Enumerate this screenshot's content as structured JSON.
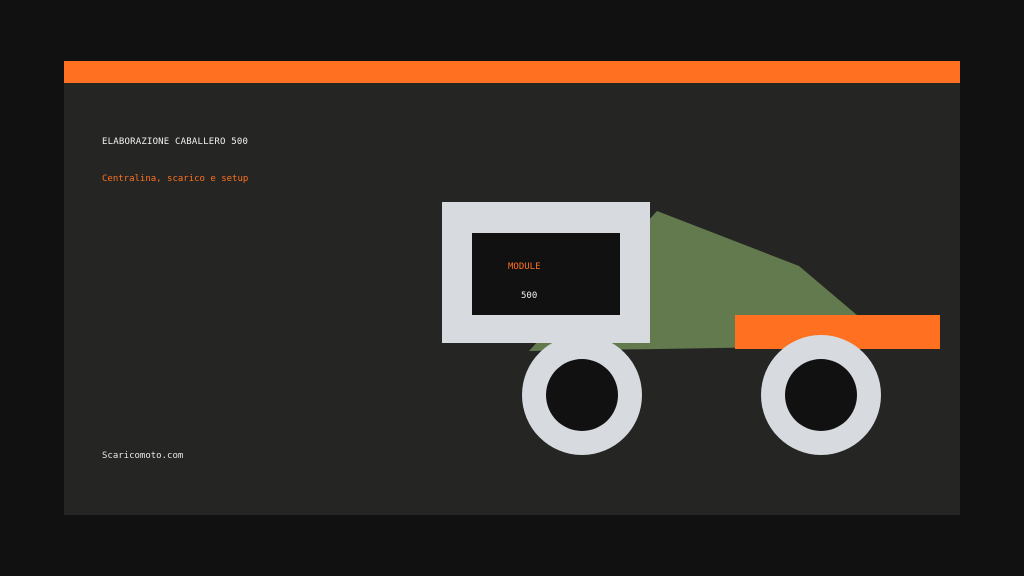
{
  "header": {
    "title": "ELABORAZIONE CABALLERO 500",
    "subtitle": "Centralina, scarico e setup"
  },
  "module": {
    "label": "MODULE",
    "value": "500"
  },
  "footer": {
    "site": "Scaricomoto.com"
  },
  "colors": {
    "accent": "#ff7020",
    "panel": "#252624",
    "background": "#111111",
    "body": "#627a4e",
    "light": "#d7dbdf",
    "dark": "#111111"
  }
}
